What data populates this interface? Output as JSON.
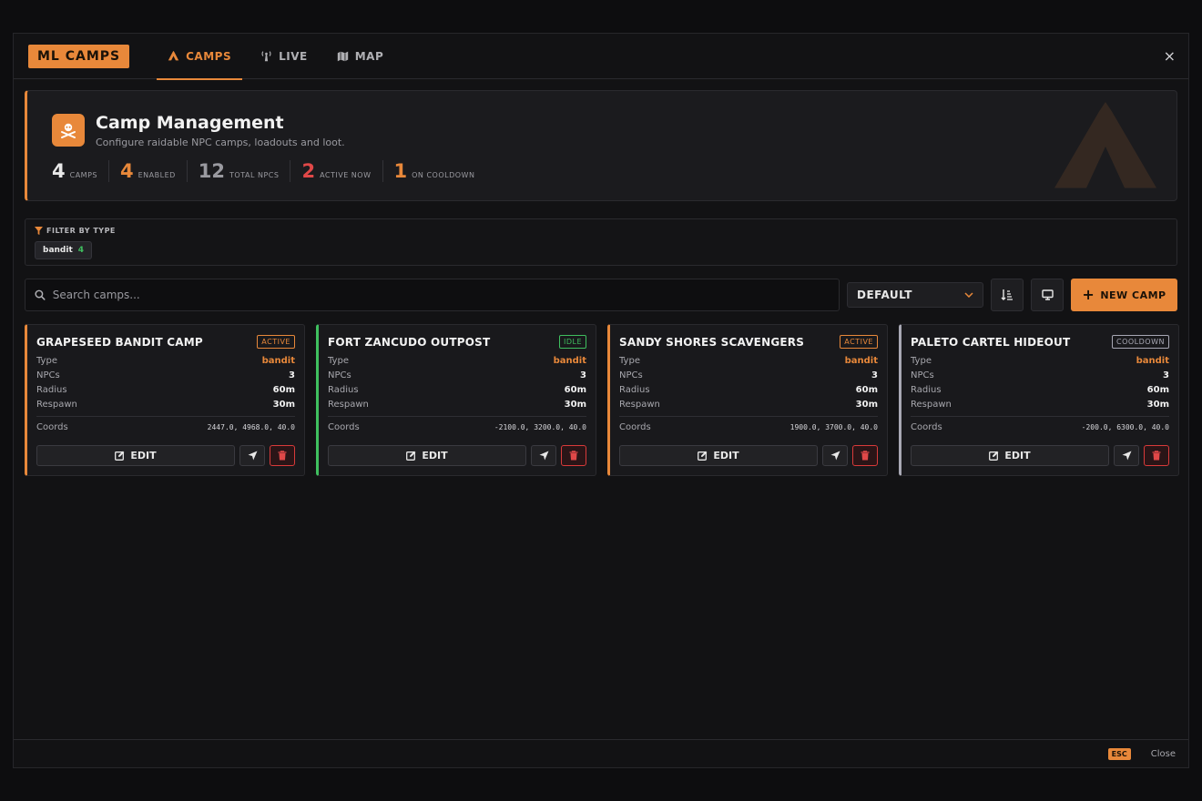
{
  "app": {
    "brand": "ML CAMPS",
    "tabs": [
      {
        "label": "CAMPS",
        "icon": "tent-icon",
        "active": true
      },
      {
        "label": "LIVE",
        "icon": "antenna-icon",
        "active": false
      },
      {
        "label": "MAP",
        "icon": "map-icon",
        "active": false
      }
    ],
    "close_glyph": "×"
  },
  "hero": {
    "title": "Camp Management",
    "subtitle": "Configure raidable NPC camps, loadouts and loot.",
    "icon": "skull-crossbones-icon",
    "stats": [
      {
        "value": "4",
        "label": "CAMPS",
        "color": "#e8e8e8"
      },
      {
        "value": "4",
        "label": "ENABLED",
        "color": "#e8883a"
      },
      {
        "value": "12",
        "label": "TOTAL NPCS",
        "color": "#9a9aa0"
      },
      {
        "value": "2",
        "label": "ACTIVE NOW",
        "color": "#e04848"
      },
      {
        "value": "1",
        "label": "ON COOLDOWN",
        "color": "#e8883a"
      }
    ]
  },
  "filter": {
    "title": "FILTER BY TYPE",
    "chips": [
      {
        "label": "bandit",
        "count": "4"
      }
    ]
  },
  "toolbar": {
    "search_placeholder": "Search camps...",
    "sort_value": "DEFAULT",
    "new_camp_label": "NEW CAMP"
  },
  "camps": [
    {
      "name": "GRAPESEED BANDIT CAMP",
      "status": "ACTIVE",
      "status_color": "#e8883a",
      "accent": "#e8883a",
      "type": "bandit",
      "npcs": "3",
      "radius": "60m",
      "respawn": "30m",
      "coords": "2447.0, 4968.0, 40.0"
    },
    {
      "name": "FORT ZANCUDO OUTPOST",
      "status": "IDLE",
      "status_color": "#3fbf5f",
      "accent": "#3fbf5f",
      "type": "bandit",
      "npcs": "3",
      "radius": "60m",
      "respawn": "30m",
      "coords": "-2100.0, 3200.0, 40.0"
    },
    {
      "name": "SANDY SHORES SCAVENGERS",
      "status": "ACTIVE",
      "status_color": "#e8883a",
      "accent": "#e8883a",
      "type": "bandit",
      "npcs": "3",
      "radius": "60m",
      "respawn": "30m",
      "coords": "1900.0, 3700.0, 40.0"
    },
    {
      "name": "PALETO CARTEL HIDEOUT",
      "status": "COOLDOWN",
      "status_color": "#a8a8b4",
      "accent": "#a8a8b4",
      "type": "bandit",
      "npcs": "3",
      "radius": "60m",
      "respawn": "30m",
      "coords": "-200.0, 6300.0, 40.0"
    }
  ],
  "labels": {
    "type": "Type",
    "npcs": "NPCs",
    "radius": "Radius",
    "respawn": "Respawn",
    "coords": "Coords",
    "edit": "EDIT"
  },
  "footer": {
    "esc": "ESC",
    "close": "Close"
  }
}
